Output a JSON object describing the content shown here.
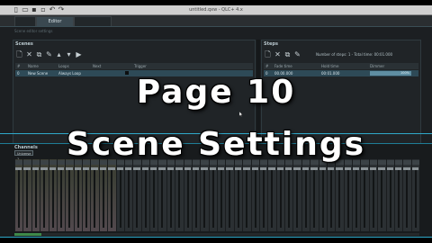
{
  "window": {
    "title": "untitled.qxw - QLC+ 4.x",
    "toolbar_icons": [
      "new-file-icon",
      "open-folder-icon",
      "save-icon",
      "save-as-icon",
      "undo-icon",
      "redo-icon"
    ]
  },
  "tabs": [
    {
      "label": ""
    },
    {
      "label": "Editor",
      "active": true
    },
    {
      "label": ""
    }
  ],
  "subtitle": "Scene editor settings",
  "scenes_panel": {
    "header": "Scenes",
    "columns": [
      "#",
      "Name",
      "Loops",
      "Next",
      "",
      "Trigger"
    ],
    "rows": [
      {
        "num": "0",
        "name": "New Scene",
        "loops": "Always Loop",
        "next": "",
        "flag": "",
        "trigger": ""
      }
    ]
  },
  "steps_panel": {
    "header": "Steps",
    "summary": "Number of steps: 1 - Total time: 00:01.000",
    "columns": [
      "#",
      "Fade time",
      "Hold time",
      "Dimmer"
    ],
    "rows": [
      {
        "num": "0",
        "fade": "00.00.000",
        "hold": "00:01.000",
        "dimmer": "100%"
      }
    ],
    "dimmer_level": 1.0
  },
  "channels": {
    "header": "Channels",
    "universe": "Universe 1",
    "strip_count": 48,
    "active_strips": 12
  },
  "overlay": {
    "line1": "Page 10",
    "line2": "Scene Settings"
  },
  "colors": {
    "accent": "#2fa8c9",
    "selection": "#2e4a57",
    "overlay_text": "#ffffff"
  }
}
